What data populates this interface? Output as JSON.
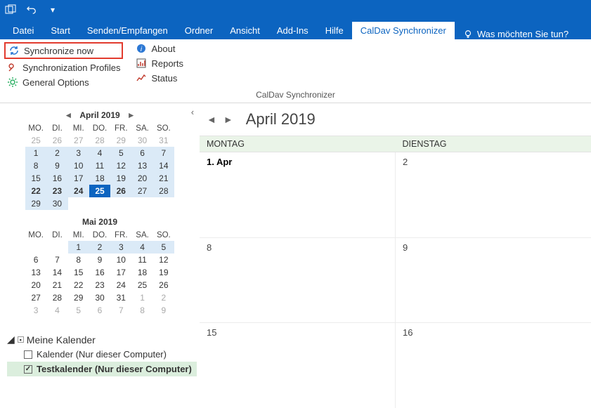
{
  "titlebar": {
    "chevron": "▾"
  },
  "ribbon_tabs": [
    "Datei",
    "Start",
    "Senden/Empfangen",
    "Ordner",
    "Ansicht",
    "Add-Ins",
    "Hilfe",
    "CalDav Synchronizer"
  ],
  "ribbon_active_index": 7,
  "search_hint": "Was möchten Sie tun?",
  "ribbon": {
    "sync_now": "Synchronize now",
    "sync_profiles": "Synchronization Profiles",
    "general_options": "General Options",
    "about": "About",
    "reports": "Reports",
    "status": "Status",
    "caption": "CalDav Synchronizer"
  },
  "mini1": {
    "title": "April 2019",
    "dow": [
      "MO.",
      "DI.",
      "MI.",
      "DO.",
      "FR.",
      "SA.",
      "SO."
    ],
    "days": [
      {
        "n": "25",
        "o": true
      },
      {
        "n": "26",
        "o": true
      },
      {
        "n": "27",
        "o": true
      },
      {
        "n": "28",
        "o": true
      },
      {
        "n": "29",
        "o": true
      },
      {
        "n": "30",
        "o": true
      },
      {
        "n": "31",
        "o": true
      },
      {
        "n": "1",
        "s": true
      },
      {
        "n": "2",
        "s": true
      },
      {
        "n": "3",
        "s": true
      },
      {
        "n": "4",
        "s": true
      },
      {
        "n": "5",
        "s": true
      },
      {
        "n": "6",
        "s": true
      },
      {
        "n": "7",
        "s": true
      },
      {
        "n": "8",
        "s": true
      },
      {
        "n": "9",
        "s": true
      },
      {
        "n": "10",
        "s": true
      },
      {
        "n": "11",
        "s": true
      },
      {
        "n": "12",
        "s": true
      },
      {
        "n": "13",
        "s": true
      },
      {
        "n": "14",
        "s": true
      },
      {
        "n": "15",
        "s": true
      },
      {
        "n": "16",
        "s": true
      },
      {
        "n": "17",
        "s": true
      },
      {
        "n": "18",
        "s": true
      },
      {
        "n": "19",
        "s": true
      },
      {
        "n": "20",
        "s": true
      },
      {
        "n": "21",
        "s": true
      },
      {
        "n": "22",
        "s": true,
        "b": true
      },
      {
        "n": "23",
        "s": true,
        "b": true
      },
      {
        "n": "24",
        "s": true,
        "b": true
      },
      {
        "n": "25",
        "sel": true
      },
      {
        "n": "26",
        "s": true,
        "b": true
      },
      {
        "n": "27",
        "s": true
      },
      {
        "n": "28",
        "s": true
      },
      {
        "n": "29",
        "s": true
      },
      {
        "n": "30",
        "s": true
      }
    ]
  },
  "mini2": {
    "title": "Mai 2019",
    "dow": [
      "MO.",
      "DI.",
      "MI.",
      "DO.",
      "FR.",
      "SA.",
      "SO."
    ],
    "days": [
      {
        "n": ""
      },
      {
        "n": ""
      },
      {
        "n": "1",
        "s": true
      },
      {
        "n": "2",
        "s": true
      },
      {
        "n": "3",
        "s": true
      },
      {
        "n": "4",
        "s": true
      },
      {
        "n": "5",
        "s": true
      },
      {
        "n": "6"
      },
      {
        "n": "7"
      },
      {
        "n": "8"
      },
      {
        "n": "9"
      },
      {
        "n": "10"
      },
      {
        "n": "11"
      },
      {
        "n": "12"
      },
      {
        "n": "13"
      },
      {
        "n": "14"
      },
      {
        "n": "15"
      },
      {
        "n": "16"
      },
      {
        "n": "17"
      },
      {
        "n": "18"
      },
      {
        "n": "19"
      },
      {
        "n": "20"
      },
      {
        "n": "21"
      },
      {
        "n": "22"
      },
      {
        "n": "23"
      },
      {
        "n": "24"
      },
      {
        "n": "25"
      },
      {
        "n": "26"
      },
      {
        "n": "27"
      },
      {
        "n": "28"
      },
      {
        "n": "29"
      },
      {
        "n": "30"
      },
      {
        "n": "31"
      },
      {
        "n": "1",
        "o": true
      },
      {
        "n": "2",
        "o": true
      },
      {
        "n": "3",
        "o": true
      },
      {
        "n": "4",
        "o": true
      },
      {
        "n": "5",
        "o": true
      },
      {
        "n": "6",
        "o": true
      },
      {
        "n": "7",
        "o": true
      },
      {
        "n": "8",
        "o": true
      },
      {
        "n": "9",
        "o": true
      }
    ]
  },
  "folders": {
    "group": "Meine Kalender",
    "items": [
      {
        "label": "Kalender (Nur dieser Computer)",
        "checked": false,
        "selected": false
      },
      {
        "label": "Testkalender (Nur dieser Computer)",
        "checked": true,
        "selected": true
      }
    ]
  },
  "main": {
    "title": "April 2019",
    "day_headers": [
      "MONTAG",
      "DIENSTAG"
    ],
    "weeks": [
      [
        {
          "n": "1. Apr",
          "first": true
        },
        {
          "n": "2"
        }
      ],
      [
        {
          "n": "8"
        },
        {
          "n": "9"
        }
      ],
      [
        {
          "n": "15"
        },
        {
          "n": "16"
        }
      ]
    ]
  }
}
